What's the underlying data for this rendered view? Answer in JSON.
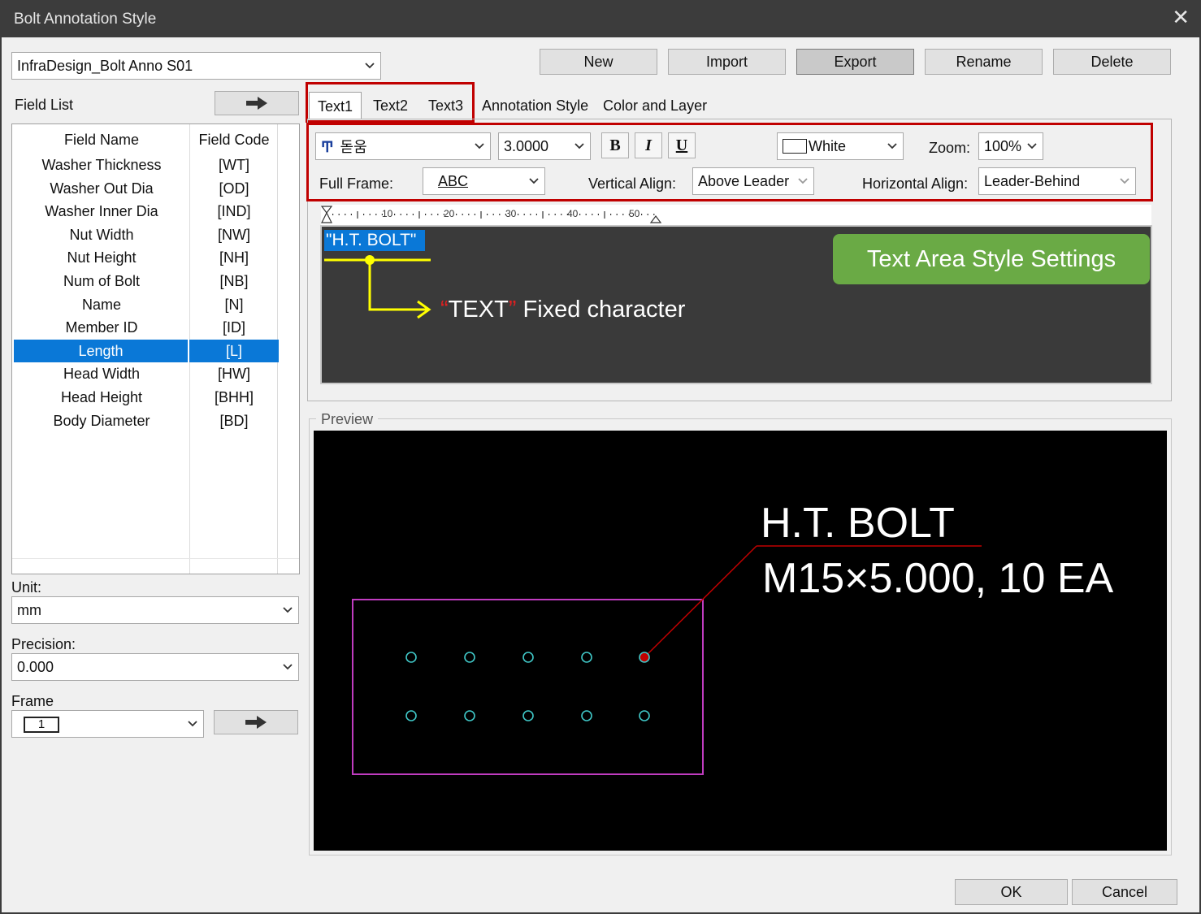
{
  "window": {
    "title": "Bolt Annotation Style",
    "close_glyph": "✕"
  },
  "style_select": {
    "value": "InfraDesign_Bolt Anno S01"
  },
  "toolbar": {
    "new": "New",
    "import": "Import",
    "export": "Export",
    "rename": "Rename",
    "delete": "Delete"
  },
  "field_list": {
    "label": "Field List",
    "header": {
      "name": "Field Name",
      "code": "Field Code"
    },
    "rows": [
      {
        "name": "Washer Thickness",
        "code": "[WT]"
      },
      {
        "name": "Washer Out Dia",
        "code": "[OD]"
      },
      {
        "name": "Washer Inner Dia",
        "code": "[IND]"
      },
      {
        "name": "Nut Width",
        "code": "[NW]"
      },
      {
        "name": "Nut Height",
        "code": "[NH]"
      },
      {
        "name": "Num of Bolt",
        "code": "[NB]"
      },
      {
        "name": "Name",
        "code": "[N]"
      },
      {
        "name": "Member ID",
        "code": "[ID]"
      },
      {
        "name": "Length",
        "code": "[L]"
      },
      {
        "name": "Head Width",
        "code": "[HW]"
      },
      {
        "name": "Head Height",
        "code": "[BHH]"
      },
      {
        "name": "Body Diameter",
        "code": "[BD]"
      }
    ],
    "selected_index": 8
  },
  "unit": {
    "label": "Unit:",
    "value": "mm"
  },
  "precision": {
    "label": "Precision:",
    "value": "0.000"
  },
  "frame": {
    "label": "Frame",
    "value": "1"
  },
  "tabs": [
    "Text1",
    "Text2",
    "Text3",
    "Annotation Style",
    "Color and Layer"
  ],
  "text_style": {
    "font": "돋움",
    "height": "3.0000",
    "bold": "B",
    "italic": "I",
    "underline": "U",
    "color": "White",
    "zoom_label": "Zoom:",
    "zoom": "100%",
    "full_frame_label": "Full Frame:",
    "full_frame": "ABC",
    "vertical_align_label": "Vertical Align:",
    "vertical_align": "Above Leader",
    "horizontal_align_label": "Horizontal Align:",
    "horizontal_align": "Leader-Behind"
  },
  "ruler": {
    "marks": [
      "10",
      "20",
      "30",
      "40",
      "50"
    ]
  },
  "editor": {
    "text": "\"H.T. BOLT\""
  },
  "callouts": {
    "text_area_style": "Text Area Style Settings",
    "fixed_quote_open": "“",
    "fixed_word": "TEXT",
    "fixed_quote_close": "”",
    "fixed_rest": " Fixed character"
  },
  "preview": {
    "label": "Preview",
    "line1": "H.T. BOLT",
    "line2": "M15×5.000, 10 EA"
  },
  "footer": {
    "ok": "OK",
    "cancel": "Cancel"
  },
  "colors": {
    "selection": "#0a78d7",
    "annotation_red": "#c00000",
    "callout_yellow": "#ffff00",
    "callout_green": "#6aaa45",
    "frame_magenta": "#c03cc0",
    "bolt_cyan": "#40c8c8",
    "leader_red": "#c00000"
  }
}
